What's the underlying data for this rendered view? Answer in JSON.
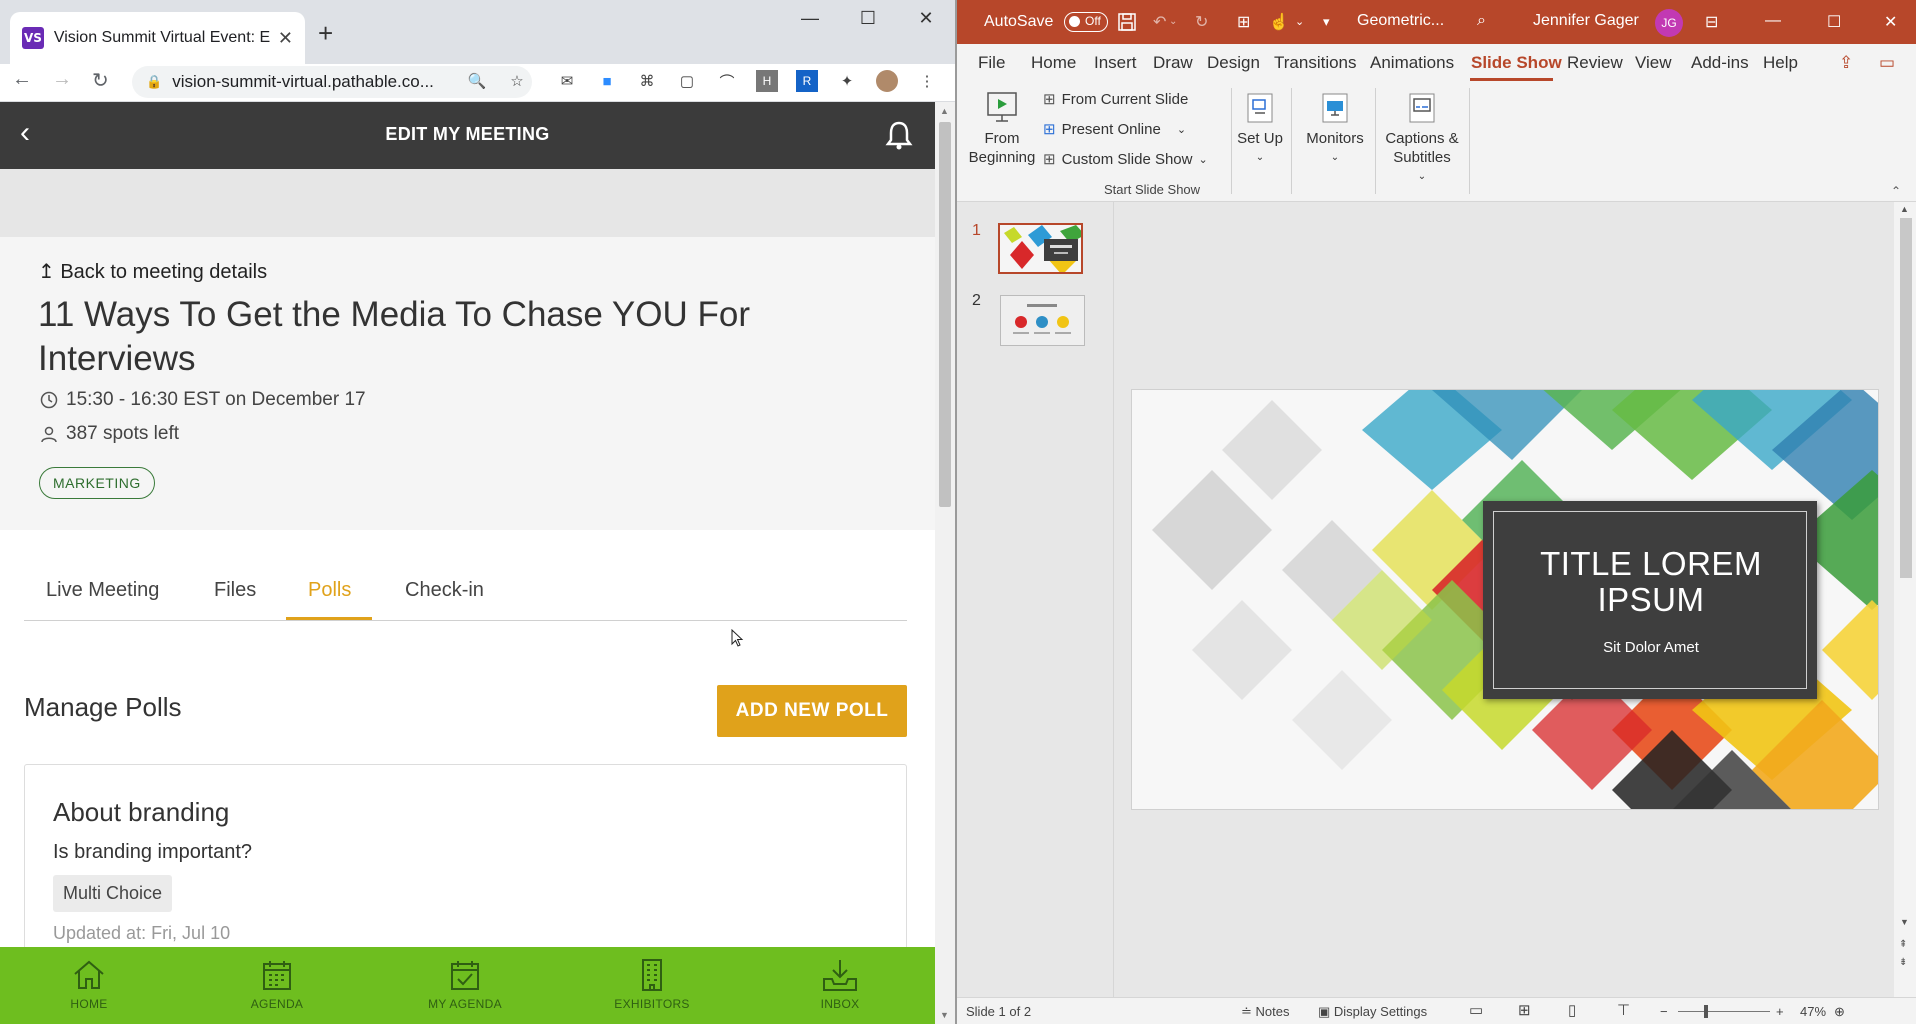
{
  "browser": {
    "tab_title": "Vision Summit Virtual Event: Edit",
    "favicon_text": "VS",
    "url": "vision-summit-virtual.pathable.co..."
  },
  "page": {
    "header_title": "EDIT MY MEETING",
    "back_link": "Back to meeting details",
    "meeting_title": "11 Ways To Get the Media To Chase YOU For Interviews",
    "time": "15:30 - 16:30 EST on December 17",
    "spots": "387 spots left",
    "tag": "MARKETING",
    "tabs": [
      {
        "label": "Live Meeting"
      },
      {
        "label": "Files"
      },
      {
        "label": "Polls"
      },
      {
        "label": "Check-in"
      }
    ],
    "active_tab": "Polls",
    "manage_title": "Manage Polls",
    "add_poll_label": "ADD NEW POLL",
    "poll": {
      "title": "About branding",
      "question": "Is branding important?",
      "type": "Multi Choice",
      "updated": "Updated at: Fri, Jul 10"
    },
    "bottom_nav": [
      {
        "label": "HOME",
        "icon": "home-icon"
      },
      {
        "label": "AGENDA",
        "icon": "calendar-icon"
      },
      {
        "label": "MY AGENDA",
        "icon": "calendar-check-icon"
      },
      {
        "label": "EXHIBITORS",
        "icon": "building-icon"
      },
      {
        "label": "INBOX",
        "icon": "inbox-icon"
      }
    ],
    "colors": {
      "accent": "#e0a21b",
      "nav_green": "#6ebe1f",
      "header": "#3b3b3b"
    }
  },
  "ppt": {
    "autosave_label": "AutoSave",
    "autosave_state": "Off",
    "file_name": "Geometric...",
    "user_name": "Jennifer Gager",
    "user_initials": "JG",
    "menu": [
      "File",
      "Home",
      "Insert",
      "Draw",
      "Design",
      "Transitions",
      "Animations",
      "Slide Show",
      "Review",
      "View",
      "Add-ins",
      "Help"
    ],
    "active_menu": "Slide Show",
    "ribbon": {
      "from_beginning": "From Beginning",
      "from_current": "From Current Slide",
      "present_online": "Present Online",
      "custom_show": "Custom Slide Show",
      "group_label": "Start Slide Show",
      "setup": "Set Up",
      "monitors": "Monitors",
      "captions": "Captions & Subtitles"
    },
    "slides": [
      {
        "number": "1"
      },
      {
        "number": "2"
      }
    ],
    "slide": {
      "title": "TITLE LOREM IPSUM",
      "subtitle": "Sit Dolor Amet"
    },
    "status": {
      "slide_counter": "Slide 1 of 2",
      "notes": "Notes",
      "display_settings": "Display Settings",
      "zoom": "47%"
    },
    "colors": {
      "brand": "#b7472a"
    }
  }
}
